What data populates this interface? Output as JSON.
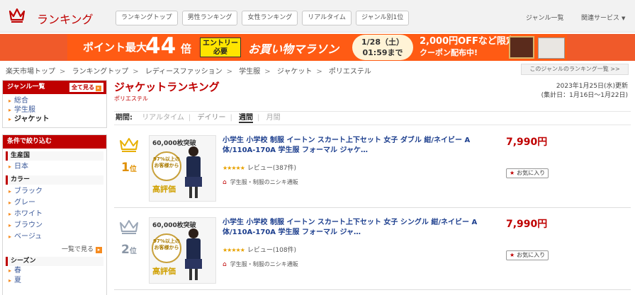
{
  "header": {
    "site_title": "ランキング",
    "tabs": [
      "ランキングトップ",
      "男性ランキング",
      "女性ランキング",
      "リアルタイム",
      "ジャンル別1位"
    ],
    "genre_list": "ジャンル一覧",
    "related": "関連サービス"
  },
  "banner": {
    "points": "ポイント最大",
    "multiplier": "44",
    "unit": "倍",
    "entry_1": "エントリー",
    "entry_2": "必要",
    "marathon": "お買い物マラソン",
    "date_1": "1/28（土）",
    "date_2": "01:59まで",
    "offer_1": "2,000円OFFなど限定",
    "offer_2": "クーポン配布中!"
  },
  "breadcrumb": [
    "楽天市場トップ",
    "ランキングトップ",
    "レディースファッション",
    "学生服",
    "ジャケット",
    "ポリエステル"
  ],
  "genre_ranking_link": "このジャンルのランキング一覧 >>",
  "sidebar": {
    "genre_title": "ジャンル一覧",
    "show_all": "全て見る",
    "genres": [
      "総合",
      "学生服",
      "ジャケット"
    ],
    "filter_title": "条件で絞り込む",
    "origin_label": "生産国",
    "origins": [
      "日本"
    ],
    "color_label": "カラー",
    "colors": [
      "ブラック",
      "グレー",
      "ホワイト",
      "ブラウン",
      "ベージュ"
    ],
    "more": "一覧で見る",
    "season_label": "シーズン",
    "seasons": [
      "春",
      "夏"
    ]
  },
  "main": {
    "title": "ジャケットランキング",
    "subtitle": "ポリエステル",
    "updated": "2023年1月25日(水)更新",
    "period_range": "(集計日：1月16日〜1月22日)",
    "period_label": "期間:",
    "periods": [
      "リアルタイム",
      "デイリー",
      "週間",
      "月間"
    ]
  },
  "items": [
    {
      "rank": "1",
      "rank_suffix": "位",
      "thumb_top": "60,000枚突破",
      "thumb_circle": "97%以上のお客様から",
      "thumb_high": "高評価",
      "name": "小学生 小学校 制服 イートン スカート上下セット 女子 ダブル 紺/ネイビー A体/110A-170A 学生服 フォーマル ジャケ…",
      "stars": "★★★★★",
      "review": "レビュー(387件)",
      "shop": "学生服・制服のニシキ通販",
      "price": "7,990円",
      "fav": "お気に入り"
    },
    {
      "rank": "2",
      "rank_suffix": "位",
      "thumb_top": "60,000枚突破",
      "thumb_circle": "97%以上のお客様から",
      "thumb_high": "高評価",
      "name": "小学生 小学校 制服 イートン スカート上下セット 女子 シングル 紺/ネイビー A体/110A-170A 学生服 フォーマル ジャ…",
      "stars": "★★★★★",
      "review": "レビュー(108件)",
      "shop": "学生服・制服のニシキ通販",
      "price": "7,990円",
      "fav": "お気に入り"
    }
  ],
  "colors": {
    "brand_red": "#bf0000",
    "banner": "#ff5b14",
    "link_blue": "#1d3f8e",
    "gold": "#e09000"
  }
}
